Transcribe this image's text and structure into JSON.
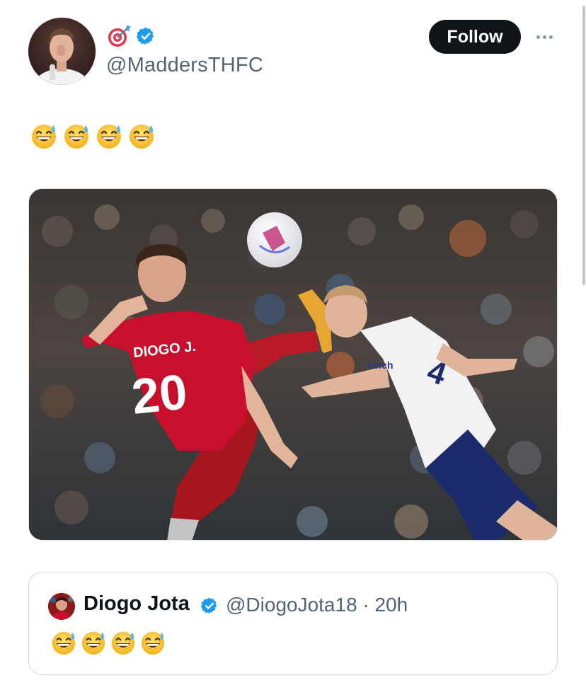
{
  "author": {
    "name_emoji": "🎯",
    "verified": true,
    "handle": "@MaddersTHFC"
  },
  "actions": {
    "follow_label": "Follow",
    "more_icon": "more-dots-icon"
  },
  "tweet": {
    "text": "😅😅😅😅"
  },
  "media": {
    "player1_name": "DIOGO J.",
    "player1_number": "20",
    "sponsor": "cinch"
  },
  "quote": {
    "name": "Diogo Jota",
    "verified": true,
    "handle_time": "@DiogoJota18 · 20h",
    "text": "😅😅😅😅"
  },
  "colors": {
    "follow_bg": "#0f1419",
    "verified_blue": "#1d9bf0",
    "handle_gray": "#536471",
    "liverpool_red": "#c8102e"
  }
}
